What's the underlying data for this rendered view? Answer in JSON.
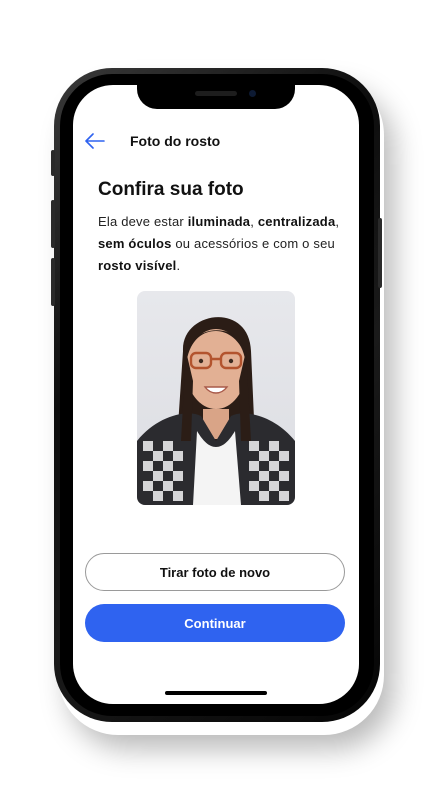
{
  "header": {
    "back_icon": "arrow-left-icon",
    "title": "Foto do rosto"
  },
  "content": {
    "heading": "Confira sua foto",
    "desc_1": "Ela deve estar ",
    "desc_b1": "iluminada",
    "desc_2": ", ",
    "desc_b2": "centralizada",
    "desc_3": ", ",
    "desc_b3": "sem óculos",
    "desc_4": " ou acessórios e com o seu ",
    "desc_b4": "rosto visível",
    "desc_5": "."
  },
  "actions": {
    "retake_label": "Tirar foto de novo",
    "continue_label": "Continuar"
  },
  "colors": {
    "accent": "#2f63f0",
    "back_icon": "#2f63f0"
  }
}
